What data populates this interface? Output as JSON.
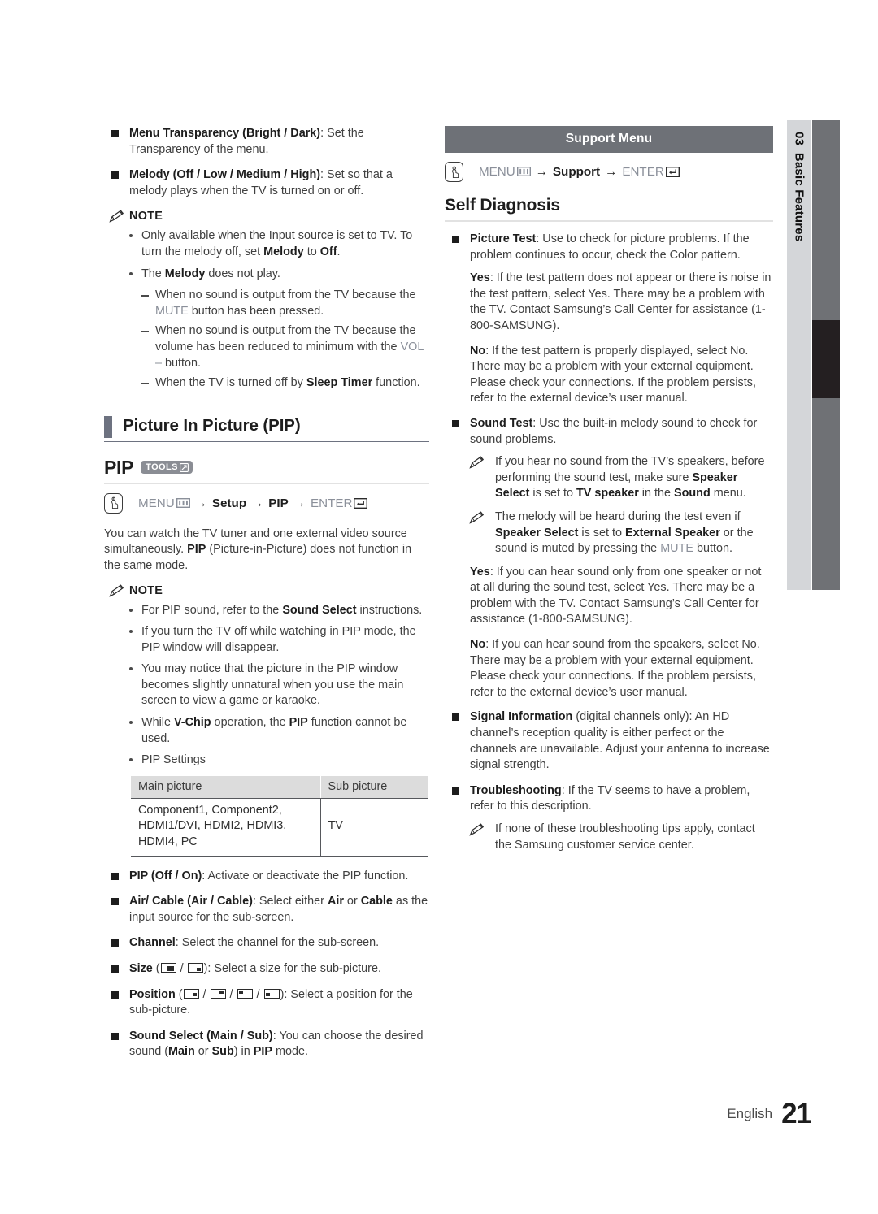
{
  "left_column": {
    "top_items": [
      {
        "bold": "Menu Transparency (Bright / Dark)",
        "rest": ": Set the Transparency of the menu."
      },
      {
        "bold": "Melody (Off / Low / Medium / High)",
        "rest": ": Set so that a melody plays when the TV is turned on or off."
      }
    ],
    "note_label": "NOTE",
    "note_bullets": [
      "Only available when the Input source is set to TV. To turn the melody off, set Melody to Off.",
      "The Melody does not play."
    ],
    "note_dashes": [
      "When no sound is output from the TV because the MUTE button has been pressed.",
      "When no sound is output from the TV because the volume has been reduced to minimum with the VOL – button.",
      "When the TV is turned off by Sleep Timer function."
    ],
    "section_heading": "Picture In Picture (PIP)",
    "pip_title": "PIP",
    "tools_badge": "TOOLS",
    "pip_path": {
      "menu": "MENU",
      "steps": [
        "Setup",
        "PIP"
      ],
      "enter": "ENTER"
    },
    "pip_intro": "You can watch the TV tuner and one external video source simultaneously. PIP (Picture-in-Picture) does not function in the same mode.",
    "pip_note_label": "NOTE",
    "pip_note_bullets": [
      "For PIP sound, refer to the Sound Select instructions.",
      "If you turn the TV off while watching in PIP mode, the PIP window will disappear.",
      "You may notice that the picture in the PIP window becomes slightly unnatural when you use the main screen to view a game or karaoke.",
      "While V-Chip operation, the PIP function cannot be used.",
      "PIP Settings"
    ],
    "pip_table": {
      "headers": [
        "Main picture",
        "Sub picture"
      ],
      "rows": [
        [
          "Component1, Component2, HDMI1/DVI, HDMI2, HDMI3, HDMI4, PC",
          "TV"
        ]
      ]
    },
    "pip_options": [
      {
        "bold": "PIP (Off / On)",
        "rest": ": Activate or deactivate the PIP function."
      },
      {
        "bold": "Air/ Cable (Air / Cable)",
        "rest": ": Select either Air or Cable as the input source for the sub-screen."
      },
      {
        "bold": "Channel",
        "rest": ": Select the channel for the sub-screen."
      },
      {
        "bold": "Size",
        "rest": ": Select a size for the sub-picture.",
        "icons": "( ■ / ▪ )"
      },
      {
        "bold": "Position",
        "rest": ": Select a position for the sub-picture.",
        "icons": "( ▪ / ▪ / ▪ / ▪ )"
      },
      {
        "bold": "Sound Select (Main / Sub)",
        "rest": ": You can choose the desired sound (Main or Sub) in PIP mode."
      }
    ]
  },
  "right_column": {
    "banner": "Support Menu",
    "support_path": {
      "menu": "MENU",
      "steps": [
        "Support"
      ],
      "enter": "ENTER"
    },
    "heading": "Self Diagnosis",
    "picture_test": {
      "bold": "Picture Test",
      "rest": ": Use to check for picture problems. If the problem continues to occur, check the Color pattern.",
      "yes_label": "Yes",
      "yes_text": ": If the test pattern does not appear or there is noise in the test pattern, select Yes. There may be a problem with the TV. Contact Samsung’s Call Center for assistance (1-800-SAMSUNG).",
      "no_label": "No",
      "no_text": ": If the test pattern is properly displayed, select No. There may be a problem with your external equipment. Please check your connections. If the problem persists, refer to the external device’s user manual."
    },
    "sound_test": {
      "bold": "Sound Test",
      "rest": ": Use the built-in melody sound to check for sound problems.",
      "notes": [
        "If you hear no sound from the TV’s speakers, before performing the sound test, make sure Speaker Select is set to TV speaker in the Sound menu.",
        "The melody will be heard during the test even if Speaker Select is set to External Speaker or the sound is muted by pressing the MUTE button."
      ],
      "yes_label": "Yes",
      "yes_text": ": If you can hear sound only from one speaker or not at all during the sound test, select Yes. There may be a problem with the TV. Contact Samsung’s Call Center for assistance (1-800-SAMSUNG).",
      "no_label": "No",
      "no_text": ": If you can hear sound from the speakers, select No. There may be a problem with your external equipment. Please check your connections. If the problem persists, refer to the external device’s user manual."
    },
    "signal_information": {
      "bold": "Signal Information",
      "rest": " (digital channels only): An HD channel’s reception quality is either perfect or the channels are unavailable. Adjust your antenna to increase signal strength."
    },
    "troubleshooting": {
      "bold": "Troubleshooting",
      "rest": ": If the TV seems to have a problem, refer to this description.",
      "note": "If none of these troubleshooting tips apply, contact the Samsung customer service center."
    }
  },
  "side_tab": {
    "chapter_number": "03",
    "chapter_title": "Basic Features"
  },
  "footer": {
    "language": "English",
    "page_number": "21"
  },
  "colors": {
    "banner_bg": "#6e7177",
    "side_tab_bg": "#d4d6d9",
    "side_bar_bg": "#6f7175",
    "side_bar_active": "#241f21",
    "accent_bar": "#6d7280",
    "dim_key": "#8b909a",
    "badge_bg": "#8a8d94",
    "table_header_bg": "#dcdcdc"
  }
}
